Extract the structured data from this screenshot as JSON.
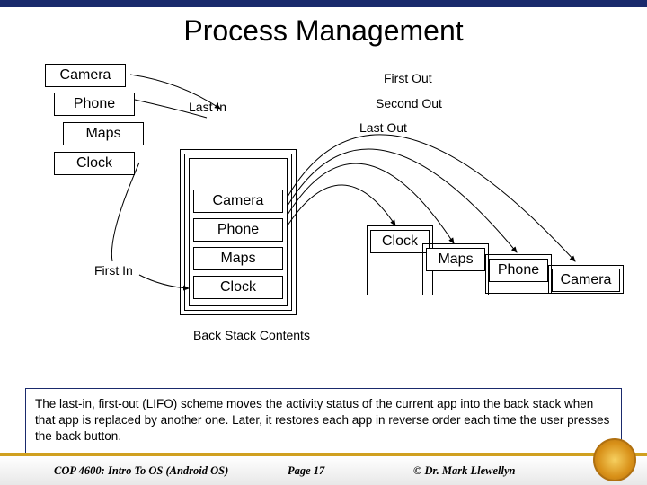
{
  "title": "Process Management",
  "left_apps": [
    "Camera",
    "Phone",
    "Maps",
    "Clock"
  ],
  "flow_labels": {
    "last_in": "Last In",
    "first_in": "First In",
    "first_out": "First Out",
    "second_out": "Second Out",
    "last_out": "Last Out"
  },
  "stack_items": [
    "Camera",
    "Phone",
    "Maps",
    "Clock"
  ],
  "right_stacks": [
    {
      "label": "Clock"
    },
    {
      "label": "Maps"
    },
    {
      "label": "Phone"
    },
    {
      "label": "Camera"
    }
  ],
  "stack_caption": "Back Stack Contents",
  "caption": "The last-in, first-out (LIFO) scheme moves the activity status of the current app into the back stack when that app is replaced by another one. Later, it restores each app in reverse order each time the user presses the back button.",
  "footer": {
    "left": "COP 4600: Intro To OS  (Android OS)",
    "center": "Page 17",
    "right": "© Dr. Mark Llewellyn"
  }
}
